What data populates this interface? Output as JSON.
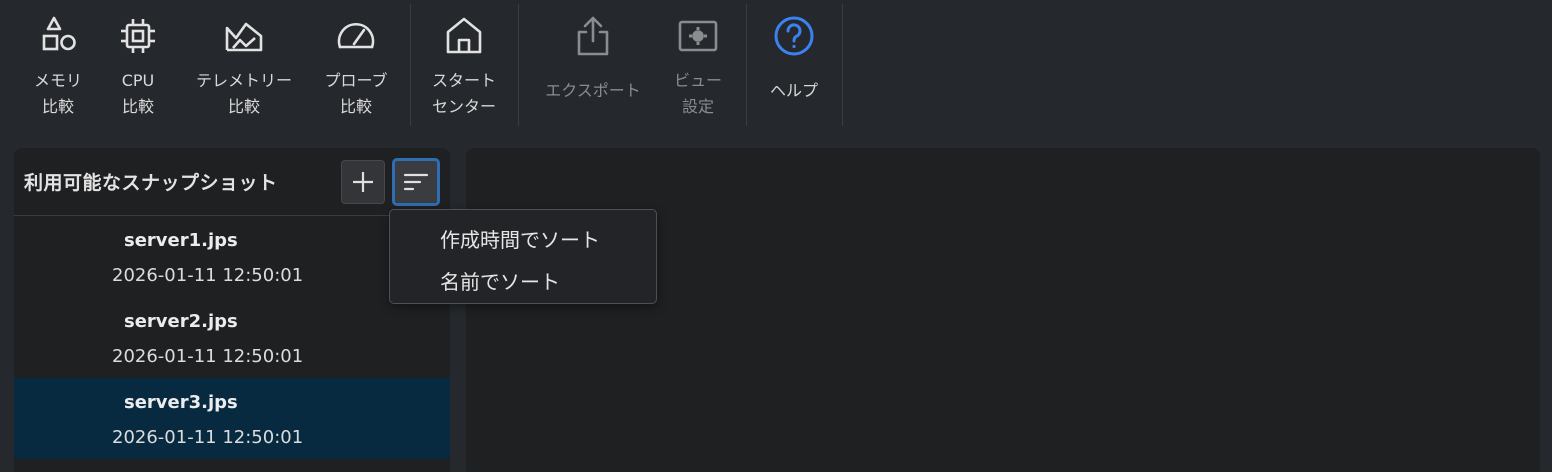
{
  "toolbar": {
    "items": [
      {
        "line1": "メモリ",
        "line2": "比較",
        "icon": "shapes-icon",
        "enabled": true
      },
      {
        "line1": "CPU",
        "line2": "比較",
        "icon": "cpu-chip-icon",
        "enabled": true
      },
      {
        "line1": "テレメトリー",
        "line2": "比較",
        "icon": "telemetry-chart-icon",
        "enabled": true
      },
      {
        "line1": "プローブ",
        "line2": "比較",
        "icon": "gauge-icon",
        "enabled": true
      },
      {
        "line1": "スタート",
        "line2": "センター",
        "icon": "home-icon",
        "enabled": true
      },
      {
        "line1": "エクスポート",
        "icon": "export-share-icon",
        "enabled": false
      },
      {
        "line1": "ビュー",
        "line2": "設定",
        "icon": "view-settings-icon",
        "enabled": false
      },
      {
        "line1": "ヘルプ",
        "icon": "help-circle-icon",
        "enabled": true
      }
    ]
  },
  "snapshots_panel": {
    "title": "利用可能なスナップショット",
    "add_button_icon": "plus-icon",
    "sort_button_icon": "sort-lines-icon",
    "items": [
      {
        "name": "server1.jps",
        "timestamp": "2026-01-11 12:50:01",
        "selected": false
      },
      {
        "name": "server2.jps",
        "timestamp": "2026-01-11 12:50:01",
        "selected": false
      },
      {
        "name": "server3.jps",
        "timestamp": "2026-01-11 12:50:01",
        "selected": true
      }
    ]
  },
  "sort_menu": {
    "items": [
      {
        "label": "作成時間でソート"
      },
      {
        "label": "名前でソート"
      }
    ]
  },
  "colors": {
    "background": "#25282c",
    "panel": "#1f2022",
    "accent": "#2f6db5",
    "help_icon": "#3b82f0",
    "selected_row": "#082a40"
  }
}
